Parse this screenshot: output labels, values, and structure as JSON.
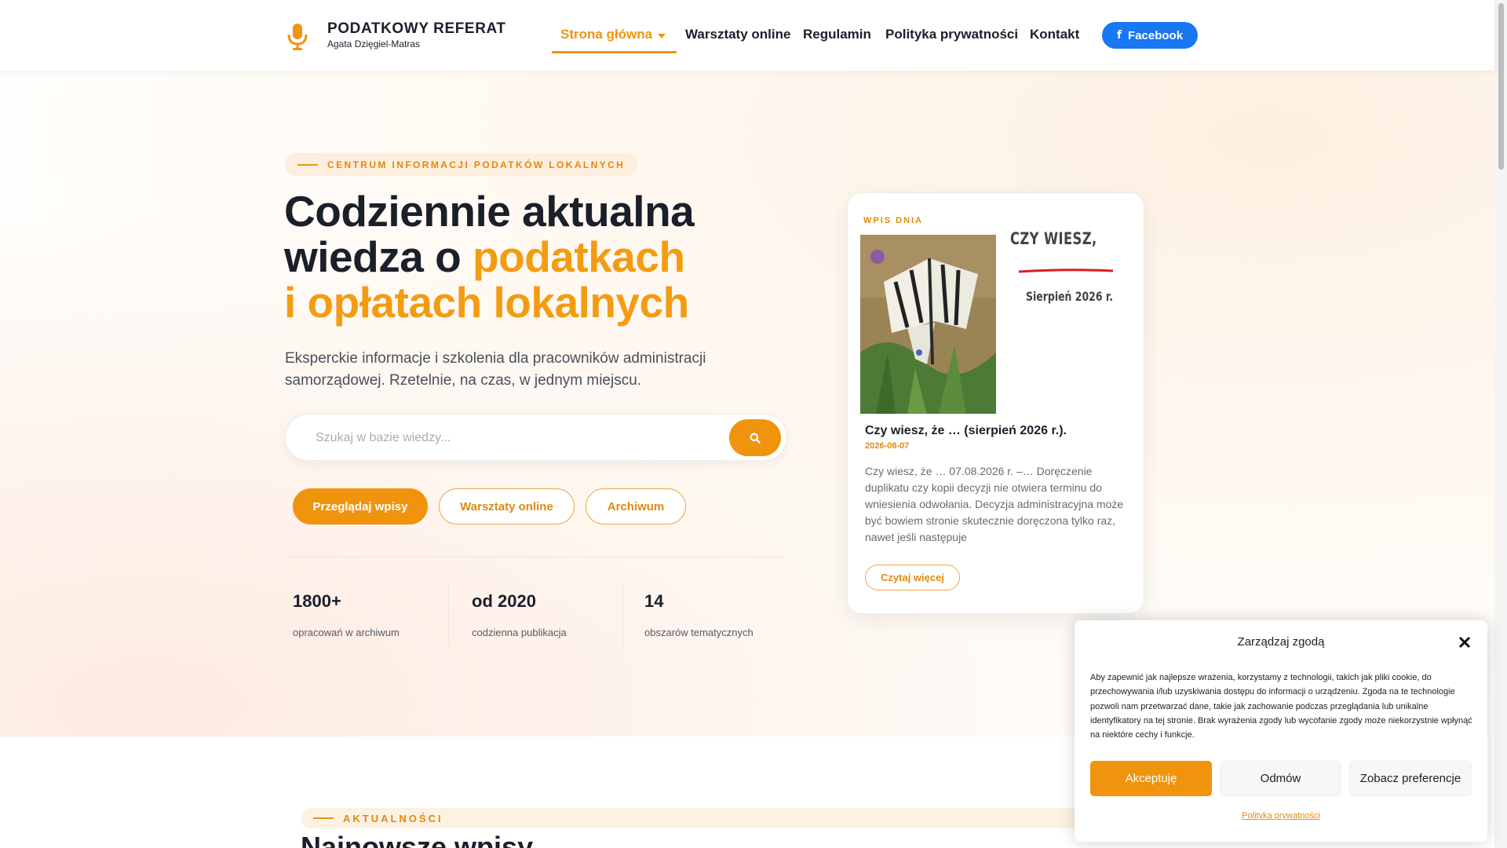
{
  "header": {
    "brand_name": "PODATKOWY REFERAT",
    "brand_sub": "Agata Dzięgiel-Matras",
    "nav": [
      {
        "label": "Strona główna"
      },
      {
        "label": "Warsztaty online"
      },
      {
        "label": "Regulamin"
      },
      {
        "label": "Polityka prywatności"
      },
      {
        "label": "Kontakt"
      }
    ],
    "facebook_label": "Facebook",
    "facebook_icon": "f"
  },
  "hero": {
    "kicker": "CENTRUM INFORMACJI PODATKÓW LOKALNYCH",
    "headline_line1": "Codziennie aktualna",
    "headline_line2_plain": "wiedza o ",
    "headline_line2_accent": "podatkach",
    "headline_line3_accent": "i opłatach lokalnych",
    "description": "Eksperckie informacje i szkolenia dla pracowników administracji samorządowej. Rzetelnie, na czas, w jednym miejscu.",
    "search_placeholder": "Szukaj w bazie wiedzy...",
    "buttons": [
      {
        "label": "Przeglądaj wpisy"
      },
      {
        "label": "Warsztaty online"
      },
      {
        "label": "Archiwum"
      }
    ],
    "stats": [
      {
        "value": "1800+",
        "label": "opracowań w archiwum"
      },
      {
        "value": "od 2020",
        "label": "codzienna publikacja"
      },
      {
        "value": "14",
        "label": "obszarów tematycznych"
      }
    ]
  },
  "featured": {
    "kicker": "WPIS DNIA",
    "image_title": "CZY WIESZ, ŻE...",
    "image_date": "Sierpień 2026 r.",
    "title": "Czy wiesz, że … (sierpień 2026 r.).",
    "date": "2026-08-07",
    "excerpt": "Czy wiesz, że … 07.08.2026 r. –… Doręczenie duplikatu czy kopii decyzji nie otwiera terminu do wniesienia odwołania. Decyzja administracyjna może być bowiem stronie skutecznie doręczona tylko raz, nawet jeśli następuje",
    "read_more": "Czytaj więcej"
  },
  "news": {
    "kicker": "AKTUALNOŚCI",
    "title": "Najnowsze wpisy"
  },
  "consent": {
    "title": "Zarządzaj zgodą",
    "text": "Aby zapewnić jak najlepsze wrażenia, korzystamy z technologii, takich jak pliki cookie, do przechowywania i/lub uzyskiwania dostępu do informacji o urządzeniu. Zgoda na te technologie pozwoli nam przetwarzać dane, takie jak zachowanie podczas przeglądania lub unikalne identyfikatory na tej stronie. Brak wyrażenia zgody lub wycofanie zgody może niekorzystnie wpłynąć na niektóre cechy i funkcje.",
    "accept": "Akceptuję",
    "deny": "Odmów",
    "preferences": "Zobacz preferencje",
    "policy_link": "Polityka prywatności"
  },
  "colors": {
    "accent": "#f0930d",
    "facebook": "#1877f2",
    "dark": "#1b1f2a"
  },
  "icons": [
    "microphone-icon",
    "caret-down-icon",
    "facebook-icon",
    "search-icon",
    "close-icon"
  ]
}
